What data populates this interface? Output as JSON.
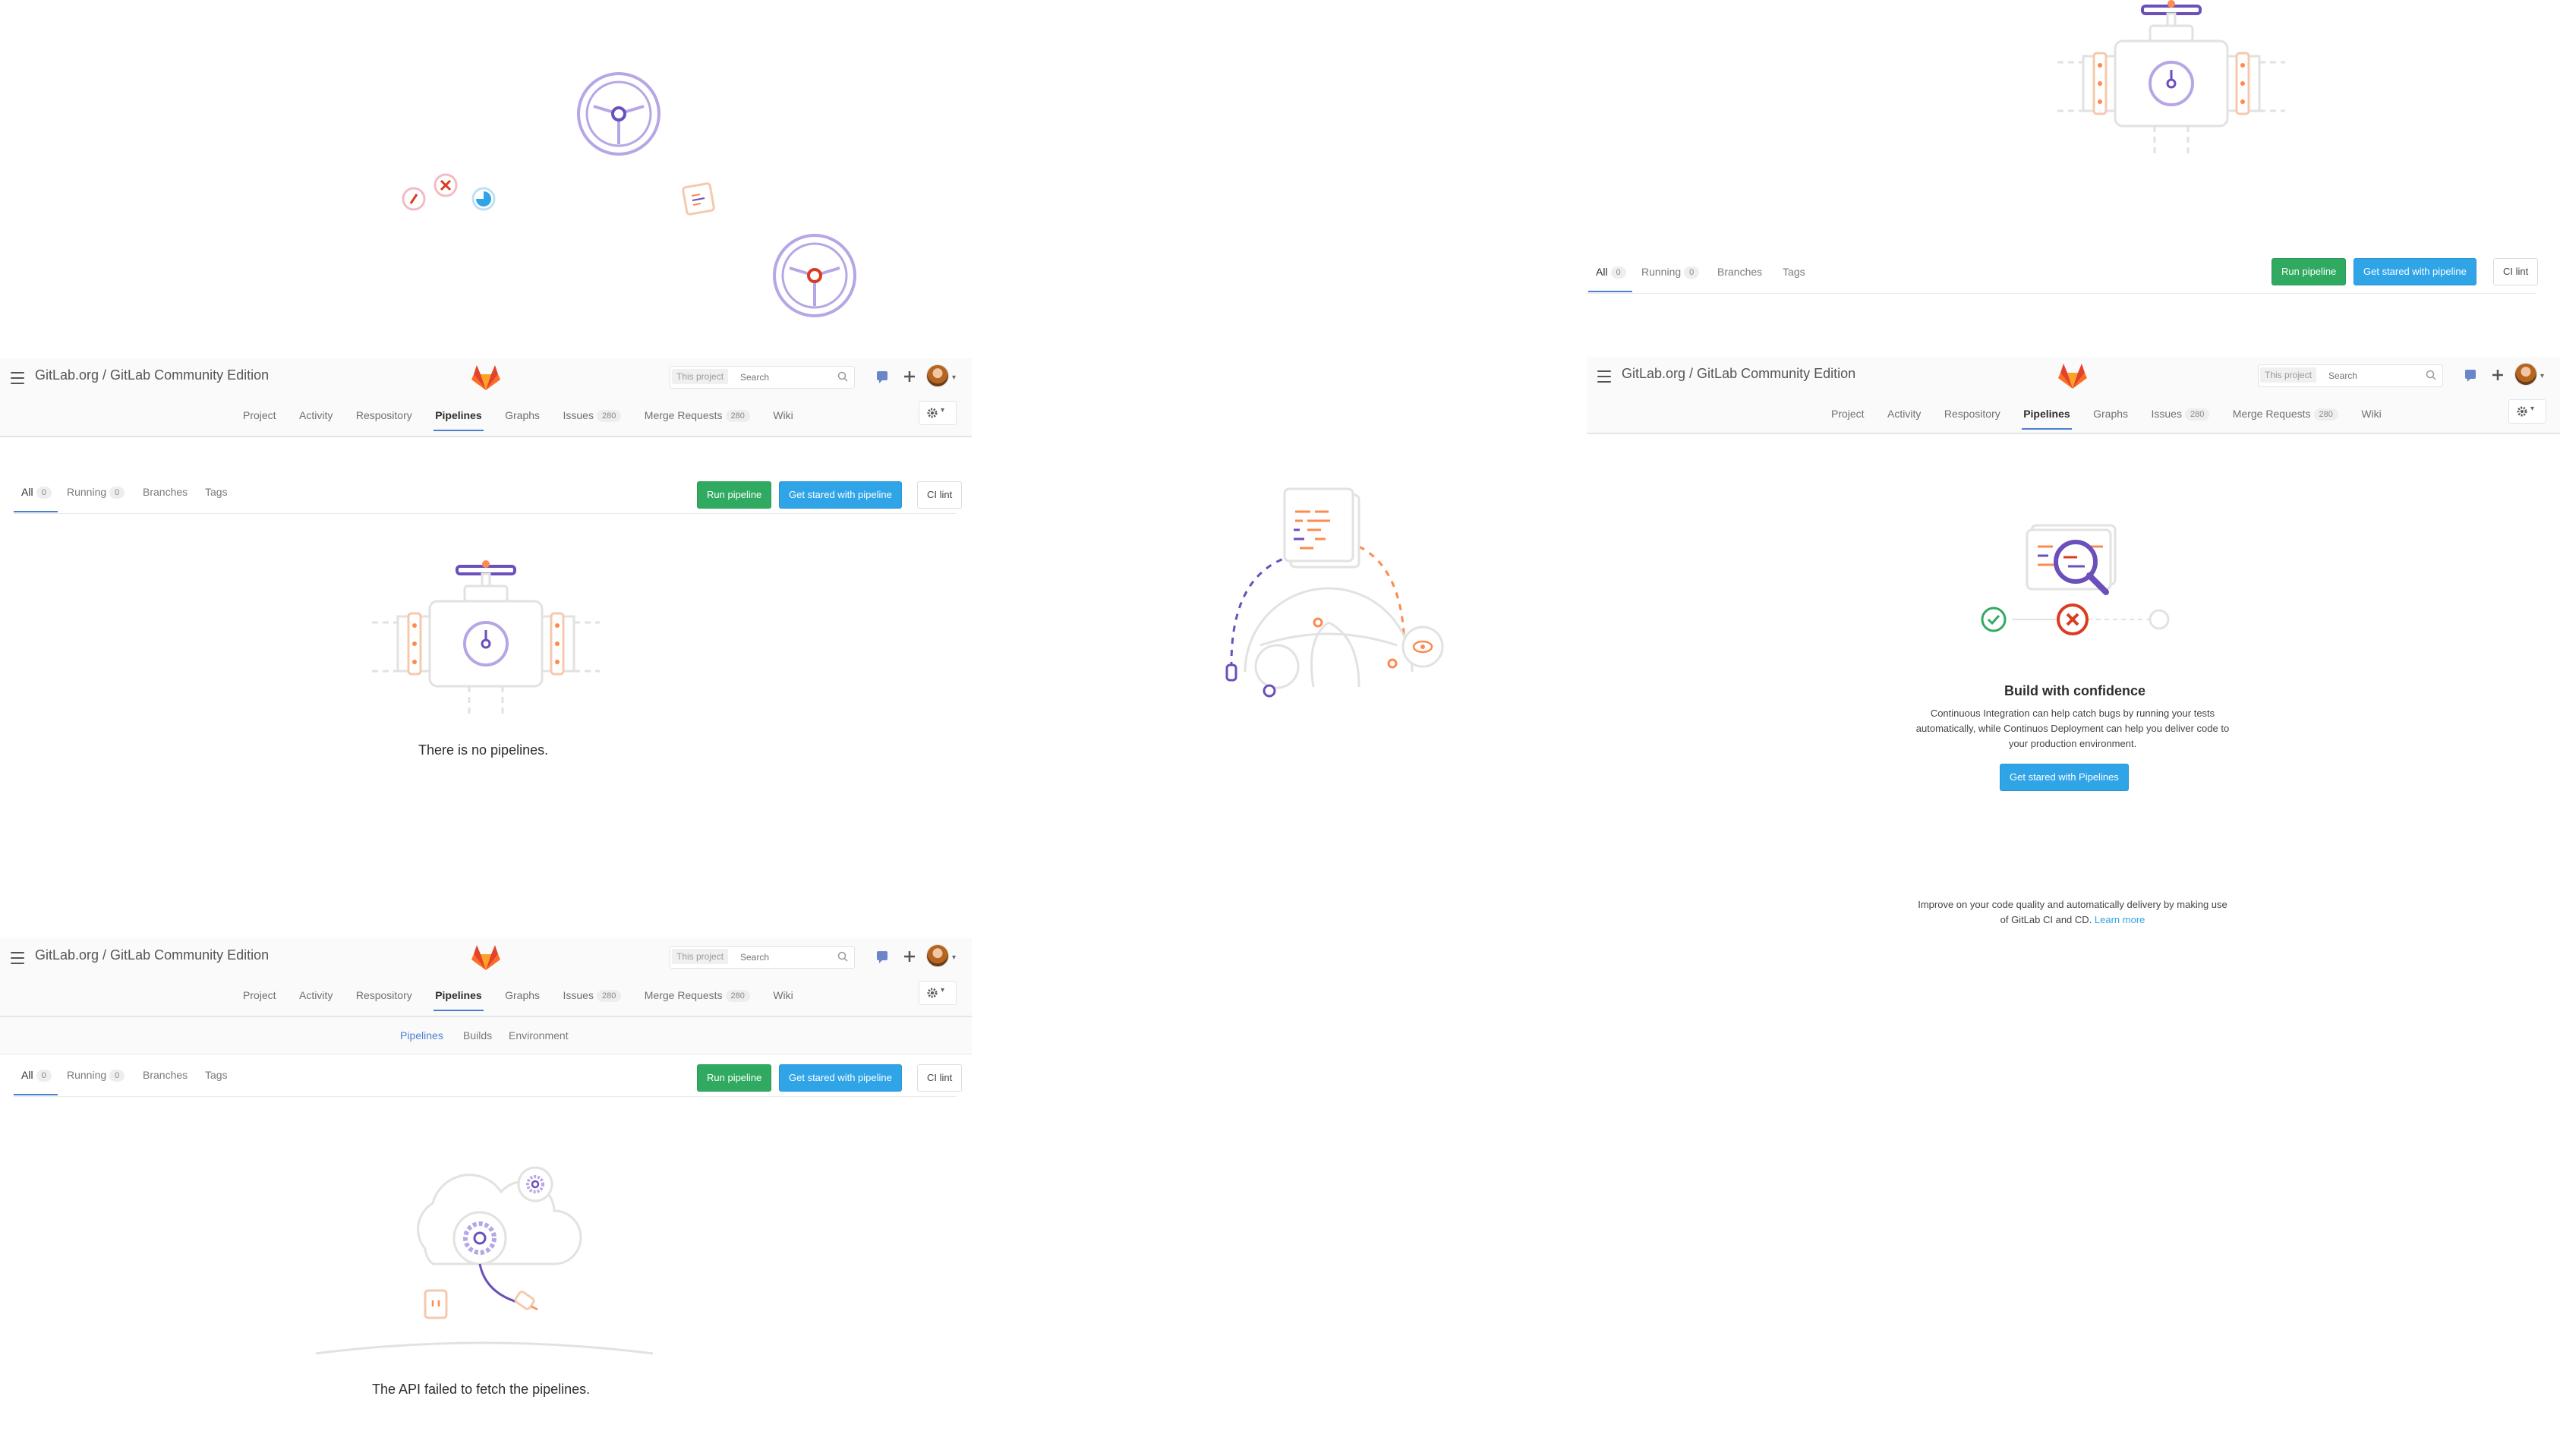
{
  "header": {
    "title": "GitLab.org / GitLab Community Edition",
    "search_scope": "This project",
    "search_placeholder": "Search",
    "nav": {
      "project": "Project",
      "activity": "Activity",
      "repository": "Respository",
      "pipelines": "Pipelines",
      "graphs": "Graphs",
      "issues": "Issues",
      "issues_count": "280",
      "merge_requests": "Merge Requests",
      "merge_requests_count": "280",
      "wiki": "Wiki"
    }
  },
  "subnav": {
    "pipelines": "Pipelines",
    "builds": "Builds",
    "environment": "Environment"
  },
  "tabs": {
    "all": "All",
    "all_count": "0",
    "running": "Running",
    "running_count": "0",
    "branches": "Branches",
    "tags": "Tags"
  },
  "buttons": {
    "run_pipeline": "Run pipeline",
    "get_started": "Get stared with pipeline",
    "ci_lint": "CI lint",
    "get_started_pipelines": "Get stared with Pipelines"
  },
  "messages": {
    "no_pipelines": "There is no pipelines.",
    "api_failed": "The API failed to fetch the pipelines.",
    "build_title": "Build with confidence",
    "build_desc_1": "Continuous Integration can help catch bugs by running your tests",
    "build_desc_2": "automatically, while Continuos Deployment can help you deliver code to",
    "build_desc_3": "your production environment.",
    "improve_1": "Improve on your code quality and automatically delivery by making use",
    "improve_2": "of GitLab CI and CD.",
    "learn_more": "Learn more"
  },
  "colors": {
    "accent": "#4a7fd1",
    "green": "#2faa60",
    "blue": "#2fa4e7",
    "purple": "#6b4fbb",
    "orange": "#fc8a51",
    "red": "#db3b21"
  },
  "icons": [
    "steering-wheel-icon",
    "gitlab-logo-icon",
    "search-icon",
    "todo-icon",
    "plus-icon",
    "gear-icon",
    "valve-pipe-icon",
    "cloud-gear-icon",
    "magnifier-icon",
    "check-icon",
    "x-icon"
  ]
}
